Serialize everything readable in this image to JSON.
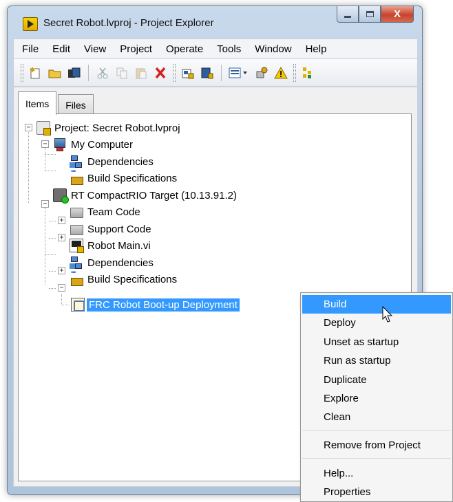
{
  "window": {
    "title": "Secret Robot.lvproj - Project Explorer",
    "buttons": {
      "minimize": "–",
      "maximize": "☐",
      "close": "X"
    }
  },
  "menu": [
    "File",
    "Edit",
    "View",
    "Project",
    "Operate",
    "Tools",
    "Window",
    "Help"
  ],
  "toolbar": {
    "icons": [
      "new-icon",
      "open-icon",
      "save-all-icon",
      "cut-icon",
      "copy-icon",
      "paste-icon",
      "delete-icon",
      "build-icon",
      "deploy-icon",
      "view-icon",
      "properties-icon",
      "warning-icon",
      "hierarchy-icon"
    ]
  },
  "tabs": [
    {
      "label": "Items",
      "active": true
    },
    {
      "label": "Files",
      "active": false
    }
  ],
  "tree": [
    {
      "label": "Project: Secret Robot.lvproj",
      "icon": "project-icon"
    },
    {
      "label": "My Computer",
      "icon": "computer-icon"
    },
    {
      "label": "Dependencies",
      "icon": "dependencies-icon"
    },
    {
      "label": "Build Specifications",
      "icon": "build-spec-icon"
    },
    {
      "label": "RT CompactRIO Target (10.13.91.2)",
      "icon": "crio-target-icon"
    },
    {
      "label": "Team Code",
      "icon": "folder-icon"
    },
    {
      "label": "Support Code",
      "icon": "folder-icon"
    },
    {
      "label": "Robot Main.vi",
      "icon": "vi-icon"
    },
    {
      "label": "Dependencies",
      "icon": "dependencies-icon"
    },
    {
      "label": "Build Specifications",
      "icon": "build-spec-icon"
    },
    {
      "label": "FRC Robot Boot-up Deployment",
      "icon": "deployment-icon",
      "selected": true
    }
  ],
  "context_menu": {
    "items": [
      "Build",
      "Deploy",
      "Unset as startup",
      "Run as startup",
      "Duplicate",
      "Explore",
      "Clean",
      "Remove from Project",
      "Help...",
      "Properties"
    ],
    "highlighted": "Build"
  },
  "colors": {
    "selection": "#3399ff",
    "window_frame": "#b9cce3"
  }
}
